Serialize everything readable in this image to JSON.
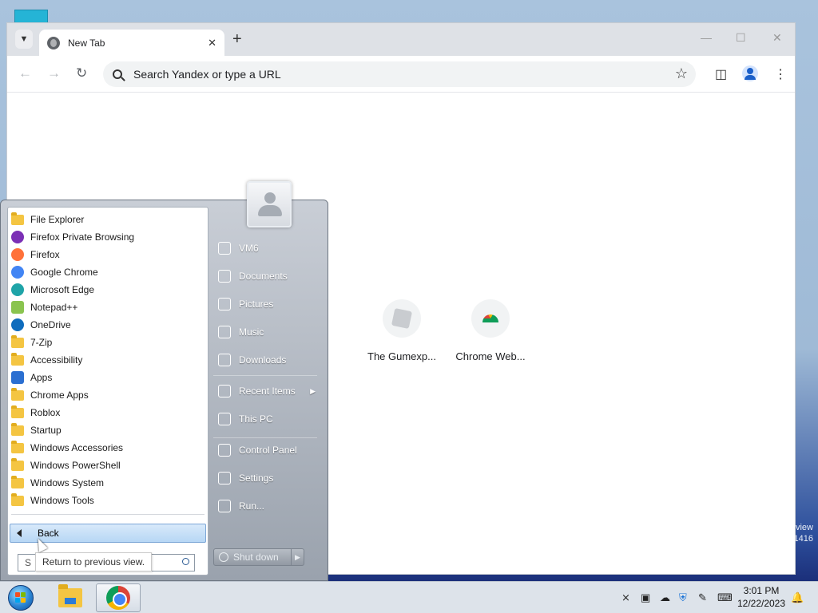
{
  "browser": {
    "tab_title": "New Tab",
    "omnibox_placeholder": "Search Yandex or type a URL"
  },
  "shortcuts": [
    {
      "label": "The Gumexp..."
    },
    {
      "label": "Chrome Web..."
    }
  ],
  "start_menu": {
    "programs": [
      {
        "label": "File Explorer",
        "icon": "file-explorer-icon",
        "color": "#f4c542"
      },
      {
        "label": "Firefox Private Browsing",
        "icon": "firefox-private-icon",
        "color": "#7b2fb5"
      },
      {
        "label": "Firefox",
        "icon": "firefox-icon",
        "color": "#ff7139"
      },
      {
        "label": "Google Chrome",
        "icon": "chrome-icon",
        "color": "#4285f4"
      },
      {
        "label": "Microsoft Edge",
        "icon": "edge-icon",
        "color": "#1fa4a8"
      },
      {
        "label": "Notepad++",
        "icon": "notepad-plus-icon",
        "color": "#8ac44f"
      },
      {
        "label": "OneDrive",
        "icon": "onedrive-icon",
        "color": "#0f6cbd"
      },
      {
        "label": "7-Zip",
        "icon": "folder-icon",
        "color": "#f4c542"
      },
      {
        "label": "Accessibility",
        "icon": "folder-icon",
        "color": "#f4c542"
      },
      {
        "label": "Apps",
        "icon": "apps-icon",
        "color": "#2b6fd1"
      },
      {
        "label": "Chrome Apps",
        "icon": "folder-icon",
        "color": "#f4c542"
      },
      {
        "label": "Roblox",
        "icon": "folder-icon",
        "color": "#f4c542"
      },
      {
        "label": "Startup",
        "icon": "folder-icon",
        "color": "#f4c542"
      },
      {
        "label": "Windows Accessories",
        "icon": "folder-icon",
        "color": "#f4c542"
      },
      {
        "label": "Windows PowerShell",
        "icon": "folder-icon",
        "color": "#f4c542"
      },
      {
        "label": "Windows System",
        "icon": "folder-icon",
        "color": "#f4c542"
      },
      {
        "label": "Windows Tools",
        "icon": "folder-icon",
        "color": "#f4c542"
      }
    ],
    "back_label": "Back",
    "search_prefix": "S",
    "tooltip": "Return to previous view.",
    "right_items": [
      {
        "label": "VM6",
        "icon": "user-folder-icon"
      },
      {
        "label": "Documents",
        "icon": "documents-icon"
      },
      {
        "label": "Pictures",
        "icon": "pictures-icon"
      },
      {
        "label": "Music",
        "icon": "music-icon"
      },
      {
        "label": "Downloads",
        "icon": "downloads-icon"
      },
      {
        "label": "Recent Items",
        "icon": "recent-items-icon"
      },
      {
        "label": "This PC",
        "icon": "computer-icon"
      },
      {
        "label": "Control Panel",
        "icon": "control-panel-icon"
      },
      {
        "label": "Settings",
        "icon": "settings-icon"
      },
      {
        "label": "Run...",
        "icon": "run-icon"
      }
    ],
    "shutdown_label": "Shut down"
  },
  "taskbar": {
    "time": "3:01 PM",
    "date": "12/22/2023"
  },
  "desktop": {
    "watermark_line1": "view",
    "watermark_line2": "1416"
  }
}
